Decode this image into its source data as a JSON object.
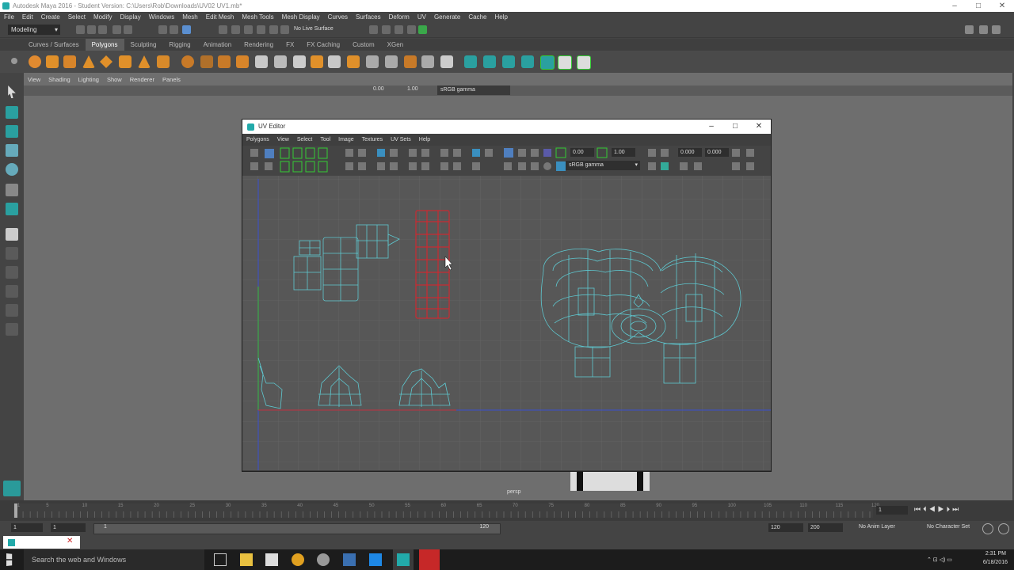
{
  "window": {
    "title": "Autodesk Maya 2016 - Student Version: C:\\Users\\Rob\\Downloads\\UV02 UV1.mb*",
    "minimize": "–",
    "maximize": "□",
    "close": "✕"
  },
  "menubar": [
    "File",
    "Edit",
    "Create",
    "Select",
    "Modify",
    "Display",
    "Windows",
    "Mesh",
    "Edit Mesh",
    "Mesh Tools",
    "Mesh Display",
    "Curves",
    "Surfaces",
    "Deform",
    "UV",
    "Generate",
    "Cache",
    "Help"
  ],
  "statusline": {
    "mode": "Modeling",
    "live_surface": "No Live Surface"
  },
  "shelf_tabs": [
    "Curves / Surfaces",
    "Polygons",
    "Sculpting",
    "Rigging",
    "Animation",
    "Rendering",
    "FX",
    "FX Caching",
    "Custom",
    "XGen"
  ],
  "shelf_active_tab": "Polygons",
  "viewport": {
    "menu": [
      "View",
      "Shading",
      "Lighting",
      "Show",
      "Renderer",
      "Panels"
    ],
    "value1": "0.00",
    "value2": "1.00",
    "color_space": "sRGB gamma",
    "camera_label": "persp"
  },
  "uv_editor": {
    "title": "UV Editor",
    "menu": [
      "Polygons",
      "View",
      "Select",
      "Tool",
      "Image",
      "Textures",
      "UV Sets",
      "Help"
    ],
    "exposure": "0.00",
    "gamma": "1.00",
    "color_space": "sRGB gamma",
    "u_value": "0.000",
    "v_value": "0.000"
  },
  "timeline": {
    "ticks": [
      "1",
      "5",
      "10",
      "15",
      "20",
      "25",
      "30",
      "35",
      "40",
      "45",
      "50",
      "55",
      "60",
      "65",
      "70",
      "75",
      "80",
      "85",
      "90",
      "95",
      "100",
      "105",
      "110",
      "115",
      "120"
    ],
    "current_frame": "1"
  },
  "range": {
    "start": "1",
    "inner_start": "1",
    "slider_start": "1",
    "slider_end": "120",
    "end": "120",
    "max": "200",
    "anim_layer": "No Anim Layer",
    "character_set": "No Character Set"
  },
  "taskbar": {
    "search_placeholder": "Search the web and Windows",
    "time": "2:31 PM",
    "date": "6/18/2016"
  },
  "colors": {
    "selected_shell": "#e0202a",
    "uv_wire": "#5ec8d0",
    "u_axis": "#3a4fd0",
    "v_axis": "#3aa84a"
  }
}
